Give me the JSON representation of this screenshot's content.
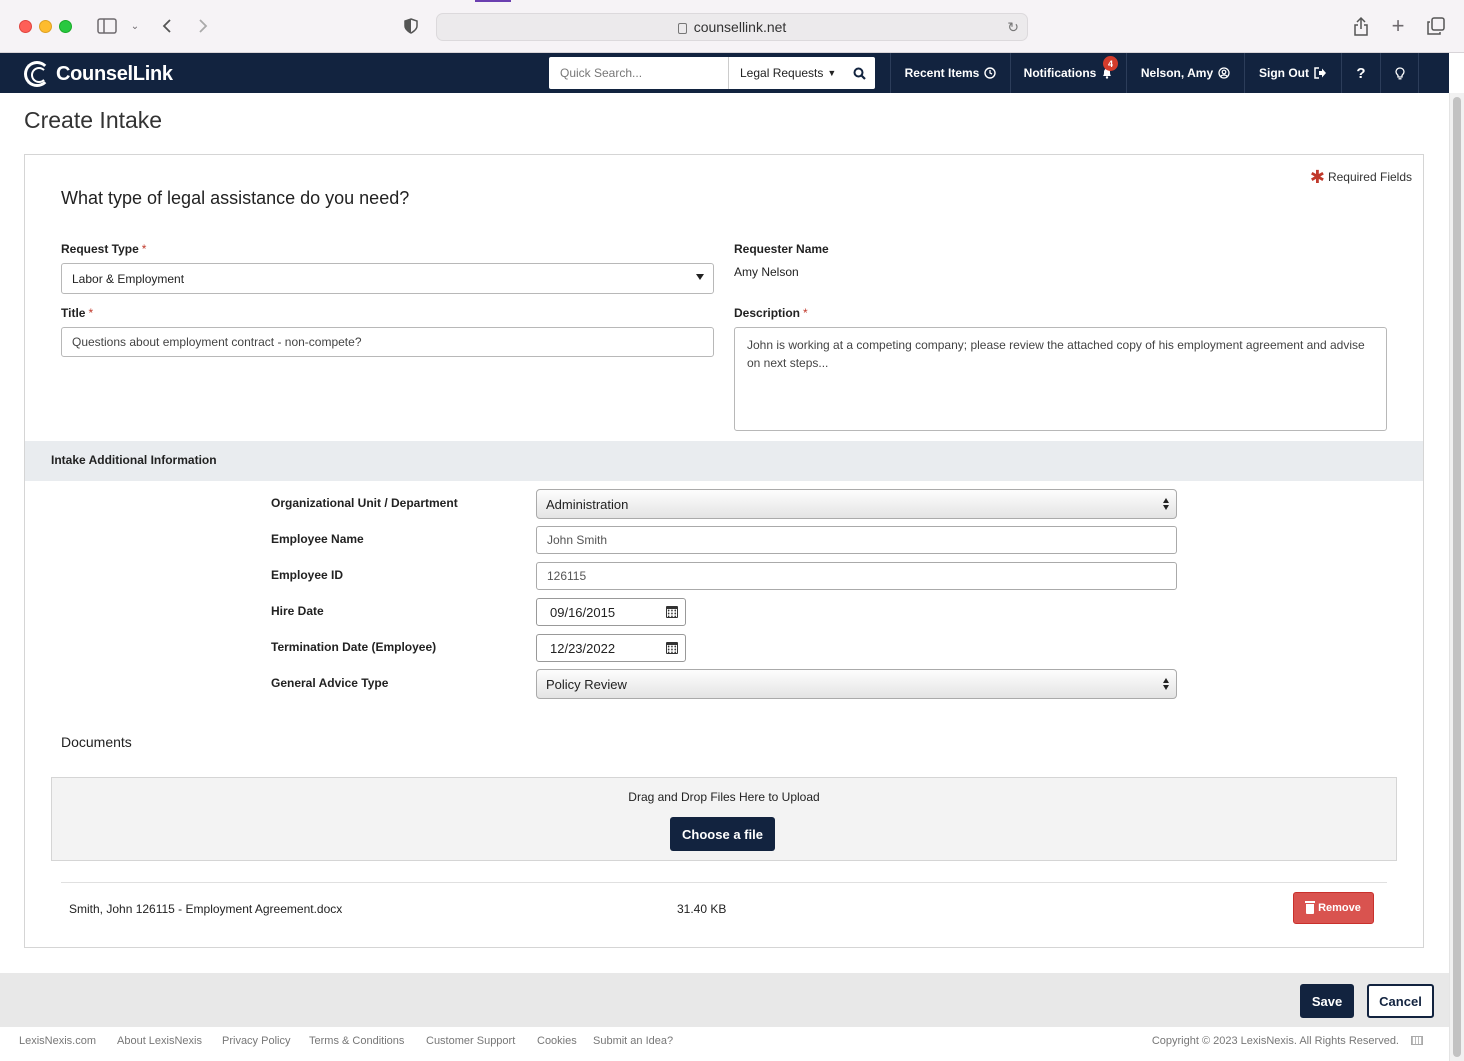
{
  "browser": {
    "url": "counsellink.net"
  },
  "app": {
    "brand": "CounselLink",
    "search": {
      "placeholder": "Quick Search...",
      "scope": "Legal Requests"
    },
    "nav": {
      "recent": "Recent Items",
      "notifications": "Notifications",
      "notification_count": "4",
      "user": "Nelson, Amy",
      "signout": "Sign Out",
      "help": "?"
    }
  },
  "page": {
    "title": "Create Intake",
    "required_note": "Required Fields",
    "question": "What type of legal assistance do you need?"
  },
  "form": {
    "request_type": {
      "label": "Request Type",
      "value": "Labor & Employment"
    },
    "requester": {
      "label": "Requester Name",
      "value": "Amy Nelson"
    },
    "title": {
      "label": "Title",
      "value": "Questions about employment contract - non-compete?"
    },
    "description": {
      "label": "Description",
      "value": "John is working at a competing company; please review the attached copy of his employment agreement and advise on next steps..."
    }
  },
  "additional": {
    "heading": "Intake Additional Information",
    "org_unit": {
      "label": "Organizational Unit / Department",
      "value": "Administration"
    },
    "employee_name": {
      "label": "Employee Name",
      "value": "John Smith"
    },
    "employee_id": {
      "label": "Employee ID",
      "value": "126115"
    },
    "hire_date": {
      "label": "Hire Date",
      "value": "09/16/2015"
    },
    "termination_date": {
      "label": "Termination Date (Employee)",
      "value": "12/23/2022"
    },
    "advice_type": {
      "label": "General Advice Type",
      "value": "Policy Review"
    }
  },
  "documents": {
    "heading": "Documents",
    "drop_text": "Drag and Drop Files Here to Upload",
    "choose_label": "Choose a file",
    "files": [
      {
        "name": "Smith, John 126115 - Employment Agreement.docx",
        "size": "31.40 KB",
        "remove_label": "Remove"
      }
    ]
  },
  "actions": {
    "save": "Save",
    "cancel": "Cancel"
  },
  "footer": {
    "links": [
      "LexisNexis.com",
      "About LexisNexis",
      "Privacy Policy",
      "Terms & Conditions",
      "Customer Support",
      "Cookies",
      "Submit an Idea?"
    ],
    "copyright": "Copyright © 2023 LexisNexis. All Rights Reserved."
  },
  "colors": {
    "navy": "#12233f",
    "required": "#c0392b",
    "danger": "#d9534f"
  }
}
